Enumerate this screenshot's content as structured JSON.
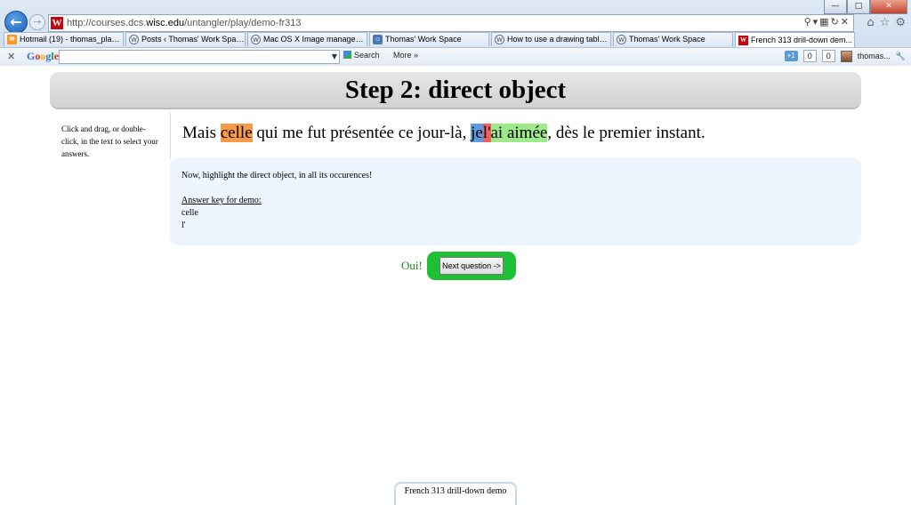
{
  "browser": {
    "url_prefix": "http://courses.dcs.",
    "url_domain": "wisc.edu",
    "url_path": "/untangler/play/demo-fr313",
    "tabs": [
      {
        "label": "Hotmail (19) - thomas_plagwit...",
        "icon": "mail-icon"
      },
      {
        "label": "Posts ‹ Thomas' Work Space ...",
        "icon": "wordpress-icon"
      },
      {
        "label": "Mac OS X Image management...",
        "icon": "wordpress-icon"
      },
      {
        "label": "Thomas' Work Space",
        "icon": "finder-icon"
      },
      {
        "label": "How to use a drawing tablet a...",
        "icon": "wordpress-icon"
      },
      {
        "label": "Thomas' Work Space",
        "icon": "wordpress-icon"
      },
      {
        "label": "French 313 drill-down dem...",
        "icon": "uw-icon",
        "active": true
      }
    ],
    "googlebar": {
      "logo": "Google",
      "search_label": "Search",
      "more_label": "More »",
      "plus_label": "+1",
      "count_a": "0",
      "count_b": "0",
      "user_label": "thomas..."
    }
  },
  "page": {
    "title": "Step 2: direct object",
    "instructions": "Click and drag, or double-click, in the text to select your answers.",
    "sentence": {
      "part1": "Mais ",
      "celle": "celle",
      "part2": " qui me fut présentée ce jour-là, ",
      "je": "je",
      "l_apos": "l'",
      "ai_aimee": "ai aimée",
      "part3": ", dès le premier instant."
    },
    "prompt": "Now, highlight the direct object, in all its occurences!",
    "answer_key_label": "Answer key for demo:",
    "answers": [
      "celle",
      "l'"
    ],
    "feedback": "Oui!",
    "next_button": "Next question ->",
    "footer": "French 313 drill-down demo"
  },
  "colors": {
    "highlight_orange": "#f79a4a",
    "highlight_blue": "#5d9be0",
    "highlight_red": "#f25f5f",
    "highlight_green": "#9ee98a",
    "success_green": "#1fbf35"
  }
}
